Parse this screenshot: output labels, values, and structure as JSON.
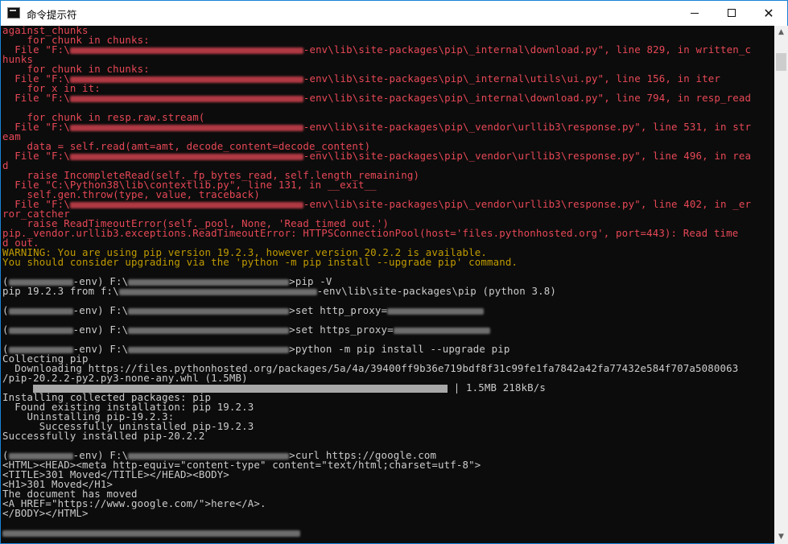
{
  "window": {
    "title": "命令提示符",
    "buttons": {
      "minimize": "—",
      "maximize": "☐",
      "close": "✕"
    }
  },
  "icons": {
    "app": "cmd-icon",
    "scroll_up": "▲",
    "scroll_down": "▼"
  },
  "colors": {
    "background": "#0c0c0c",
    "error": "#e74856",
    "warning": "#c19c00",
    "text": "#cccccc"
  },
  "console": {
    "lines": [
      "against_chunks",
      "    for chunk in chunks:",
      "  File \"F:\\",
      "-env\\lib\\site-packages\\pip\\_internal\\download.py\", line 829, in written_c",
      "hunks",
      "    for chunk in chunks:",
      "  File \"F:\\",
      "-env\\lib\\site-packages\\pip\\_internal\\utils\\ui.py\", line 156, in iter",
      "    for x in it:",
      "  File \"F:\\",
      "-env\\lib\\site-packages\\pip\\_internal\\download.py\", line 794, in resp_read",
      "",
      "    for chunk in resp.raw.stream(",
      "  File \"F:\\",
      "-env\\lib\\site-packages\\pip\\_vendor\\urllib3\\response.py\", line 531, in str",
      "eam",
      "    data = self.read(amt=amt, decode_content=decode_content)",
      "  File \"F:\\",
      "-env\\lib\\site-packages\\pip\\_vendor\\urllib3\\response.py\", line 496, in rea",
      "d",
      "    raise IncompleteRead(self._fp_bytes_read, self.length_remaining)",
      "  File \"C:\\Python38\\lib\\contextlib.py\", line 131, in __exit__",
      "    self.gen.throw(type, value, traceback)",
      "  File \"F:\\",
      "-env\\lib\\site-packages\\pip\\_vendor\\urllib3\\response.py\", line 402, in _er",
      "ror_catcher",
      "    raise ReadTimeoutError(self._pool, None, 'Read timed out.')",
      "pip._vendor.urllib3.exceptions.ReadTimeoutError: HTTPSConnectionPool(host='files.pythonhosted.org', port=443): Read time",
      "d out.",
      "WARNING: You are using pip version 19.2.3, however version 20.2.2 is available.",
      "You should consider upgrading via the 'python -m pip install --upgrade pip' command.",
      "",
      "(",
      "-env) F:\\",
      ">pip -V",
      "pip 19.2.3 from f:\\",
      "-env\\lib\\site-packages\\pip (python 3.8)",
      ">set http_proxy=",
      ">set https_proxy=",
      ">python -m pip install --upgrade pip",
      "Collecting pip",
      "  Downloading https://files.pythonhosted.org/packages/5a/4a/39400ff9b36e719bdf8f31c99fe1fa7842a42fa77432e584f707a5080063",
      "/pip-20.2.2-py2.py3-none-any.whl (1.5MB)",
      "| 1.5MB 218kB/s",
      "Installing collected packages: pip",
      "  Found existing installation: pip 19.2.3",
      "    Uninstalling pip-19.2.3:",
      "      Successfully uninstalled pip-19.2.3",
      "Successfully installed pip-20.2.2",
      ">curl https://google.com",
      "<HTML><HEAD><meta http-equiv=\"content-type\" content=\"text/html;charset=utf-8\">",
      "<TITLE>301 Moved</TITLE></HEAD><BODY>",
      "<H1>301 Moved</H1>",
      "The document has moved",
      "<A HREF=\"https://www.google.com/\">here</A>.",
      "</BODY></HTML>"
    ]
  }
}
